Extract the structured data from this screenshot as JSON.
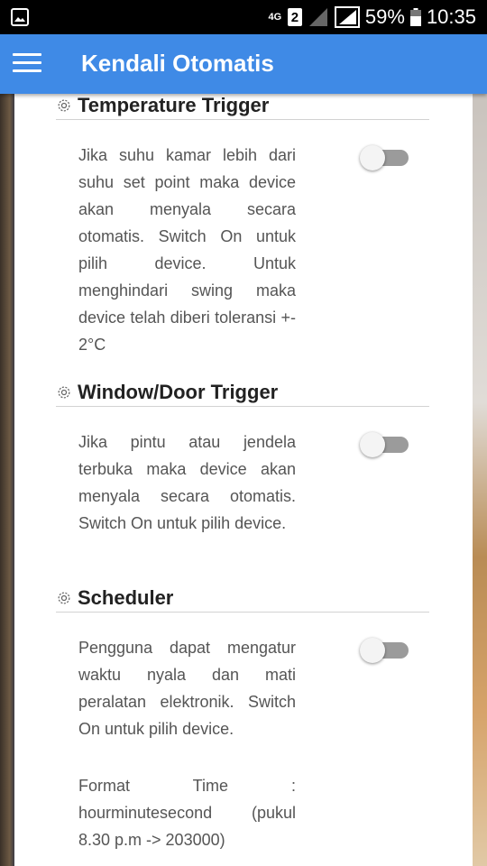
{
  "status_bar": {
    "network_label": "4G",
    "sim_number": "2",
    "battery_percent": "59%",
    "time": "10:35",
    "icons": [
      "image-icon",
      "signal-icon",
      "battery-icon"
    ]
  },
  "app_bar": {
    "title": "Kendali Otomatis",
    "menu_icon": "hamburger-menu-icon",
    "color": "#3f8ae6"
  },
  "sections": [
    {
      "title": "Temperature Trigger",
      "description": "Jika suhu kamar lebih dari suhu set point maka device akan menyala secara otomatis. Switch On untuk pilih device. Untuk menghindari swing maka device telah diberi toleransi +- 2°C",
      "toggle_on": false
    },
    {
      "title": "Window/Door Trigger",
      "description": "Jika pintu atau jendela terbuka maka device akan menyala secara otomatis. Switch On untuk pilih device.",
      "toggle_on": false
    },
    {
      "title": "Scheduler",
      "description": "Pengguna dapat mengatur waktu nyala dan mati peralatan elektronik. Switch On untuk pilih device.",
      "note": "Format Time : hourminutesecond (pukul 8.30 p.m -> 203000)",
      "toggle_on": false
    }
  ]
}
